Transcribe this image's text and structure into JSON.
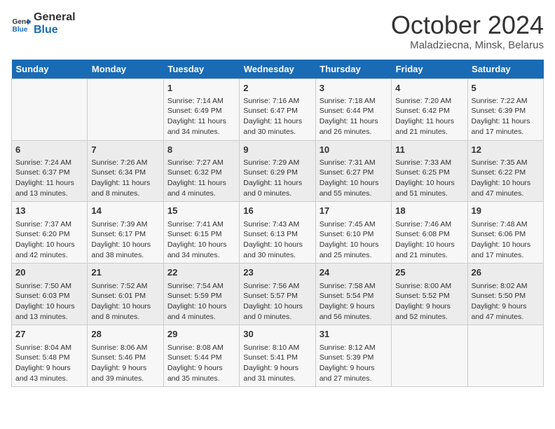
{
  "logo": {
    "line1": "General",
    "line2": "Blue"
  },
  "title": "October 2024",
  "subtitle": "Maladziecna, Minsk, Belarus",
  "days": [
    "Sunday",
    "Monday",
    "Tuesday",
    "Wednesday",
    "Thursday",
    "Friday",
    "Saturday"
  ],
  "weeks": [
    [
      {
        "day": "",
        "text": ""
      },
      {
        "day": "",
        "text": ""
      },
      {
        "day": "1",
        "text": "Sunrise: 7:14 AM\nSunset: 6:49 PM\nDaylight: 11 hours and 34 minutes."
      },
      {
        "day": "2",
        "text": "Sunrise: 7:16 AM\nSunset: 6:47 PM\nDaylight: 11 hours and 30 minutes."
      },
      {
        "day": "3",
        "text": "Sunrise: 7:18 AM\nSunset: 6:44 PM\nDaylight: 11 hours and 26 minutes."
      },
      {
        "day": "4",
        "text": "Sunrise: 7:20 AM\nSunset: 6:42 PM\nDaylight: 11 hours and 21 minutes."
      },
      {
        "day": "5",
        "text": "Sunrise: 7:22 AM\nSunset: 6:39 PM\nDaylight: 11 hours and 17 minutes."
      }
    ],
    [
      {
        "day": "6",
        "text": "Sunrise: 7:24 AM\nSunset: 6:37 PM\nDaylight: 11 hours and 13 minutes."
      },
      {
        "day": "7",
        "text": "Sunrise: 7:26 AM\nSunset: 6:34 PM\nDaylight: 11 hours and 8 minutes."
      },
      {
        "day": "8",
        "text": "Sunrise: 7:27 AM\nSunset: 6:32 PM\nDaylight: 11 hours and 4 minutes."
      },
      {
        "day": "9",
        "text": "Sunrise: 7:29 AM\nSunset: 6:29 PM\nDaylight: 11 hours and 0 minutes."
      },
      {
        "day": "10",
        "text": "Sunrise: 7:31 AM\nSunset: 6:27 PM\nDaylight: 10 hours and 55 minutes."
      },
      {
        "day": "11",
        "text": "Sunrise: 7:33 AM\nSunset: 6:25 PM\nDaylight: 10 hours and 51 minutes."
      },
      {
        "day": "12",
        "text": "Sunrise: 7:35 AM\nSunset: 6:22 PM\nDaylight: 10 hours and 47 minutes."
      }
    ],
    [
      {
        "day": "13",
        "text": "Sunrise: 7:37 AM\nSunset: 6:20 PM\nDaylight: 10 hours and 42 minutes."
      },
      {
        "day": "14",
        "text": "Sunrise: 7:39 AM\nSunset: 6:17 PM\nDaylight: 10 hours and 38 minutes."
      },
      {
        "day": "15",
        "text": "Sunrise: 7:41 AM\nSunset: 6:15 PM\nDaylight: 10 hours and 34 minutes."
      },
      {
        "day": "16",
        "text": "Sunrise: 7:43 AM\nSunset: 6:13 PM\nDaylight: 10 hours and 30 minutes."
      },
      {
        "day": "17",
        "text": "Sunrise: 7:45 AM\nSunset: 6:10 PM\nDaylight: 10 hours and 25 minutes."
      },
      {
        "day": "18",
        "text": "Sunrise: 7:46 AM\nSunset: 6:08 PM\nDaylight: 10 hours and 21 minutes."
      },
      {
        "day": "19",
        "text": "Sunrise: 7:48 AM\nSunset: 6:06 PM\nDaylight: 10 hours and 17 minutes."
      }
    ],
    [
      {
        "day": "20",
        "text": "Sunrise: 7:50 AM\nSunset: 6:03 PM\nDaylight: 10 hours and 13 minutes."
      },
      {
        "day": "21",
        "text": "Sunrise: 7:52 AM\nSunset: 6:01 PM\nDaylight: 10 hours and 8 minutes."
      },
      {
        "day": "22",
        "text": "Sunrise: 7:54 AM\nSunset: 5:59 PM\nDaylight: 10 hours and 4 minutes."
      },
      {
        "day": "23",
        "text": "Sunrise: 7:56 AM\nSunset: 5:57 PM\nDaylight: 10 hours and 0 minutes."
      },
      {
        "day": "24",
        "text": "Sunrise: 7:58 AM\nSunset: 5:54 PM\nDaylight: 9 hours and 56 minutes."
      },
      {
        "day": "25",
        "text": "Sunrise: 8:00 AM\nSunset: 5:52 PM\nDaylight: 9 hours and 52 minutes."
      },
      {
        "day": "26",
        "text": "Sunrise: 8:02 AM\nSunset: 5:50 PM\nDaylight: 9 hours and 47 minutes."
      }
    ],
    [
      {
        "day": "27",
        "text": "Sunrise: 8:04 AM\nSunset: 5:48 PM\nDaylight: 9 hours and 43 minutes."
      },
      {
        "day": "28",
        "text": "Sunrise: 8:06 AM\nSunset: 5:46 PM\nDaylight: 9 hours and 39 minutes."
      },
      {
        "day": "29",
        "text": "Sunrise: 8:08 AM\nSunset: 5:44 PM\nDaylight: 9 hours and 35 minutes."
      },
      {
        "day": "30",
        "text": "Sunrise: 8:10 AM\nSunset: 5:41 PM\nDaylight: 9 hours and 31 minutes."
      },
      {
        "day": "31",
        "text": "Sunrise: 8:12 AM\nSunset: 5:39 PM\nDaylight: 9 hours and 27 minutes."
      },
      {
        "day": "",
        "text": ""
      },
      {
        "day": "",
        "text": ""
      }
    ]
  ]
}
